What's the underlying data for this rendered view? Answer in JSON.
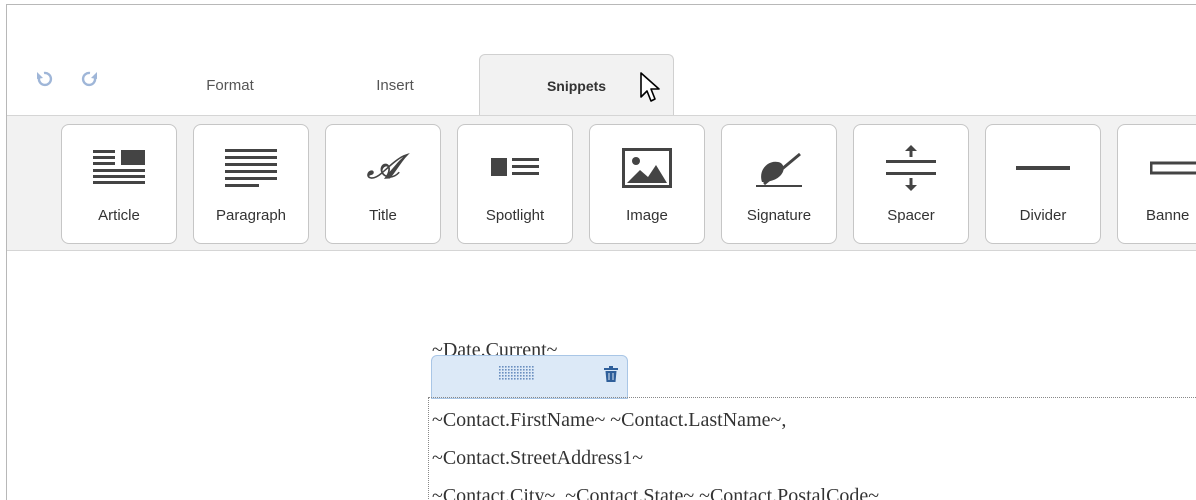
{
  "tabs": {
    "format": "Format",
    "insert": "Insert",
    "snippets": "Snippets"
  },
  "snippets": [
    {
      "label": "Article",
      "icon": "article-icon"
    },
    {
      "label": "Paragraph",
      "icon": "paragraph-icon"
    },
    {
      "label": "Title",
      "icon": "title-icon"
    },
    {
      "label": "Spotlight",
      "icon": "spotlight-icon"
    },
    {
      "label": "Image",
      "icon": "image-icon"
    },
    {
      "label": "Signature",
      "icon": "signature-icon"
    },
    {
      "label": "Spacer",
      "icon": "spacer-icon"
    },
    {
      "label": "Divider",
      "icon": "divider-icon"
    },
    {
      "label": "Banne",
      "icon": "banner-icon"
    }
  ],
  "editor": {
    "date_line": "~Date.Current~",
    "lines": [
      "~Contact.FirstName~ ~Contact.LastName~,",
      "~Contact.StreetAddress1~",
      "~Contact.City~, ~Contact.State~ ~Contact.PostalCode~"
    ]
  },
  "colors": {
    "icon_gray": "#444444",
    "toolbar_bg": "#f2f2f2",
    "handle_bg": "#dce9f7",
    "handle_border": "#a9c6e6",
    "history_icons": "#9fb6d8"
  }
}
